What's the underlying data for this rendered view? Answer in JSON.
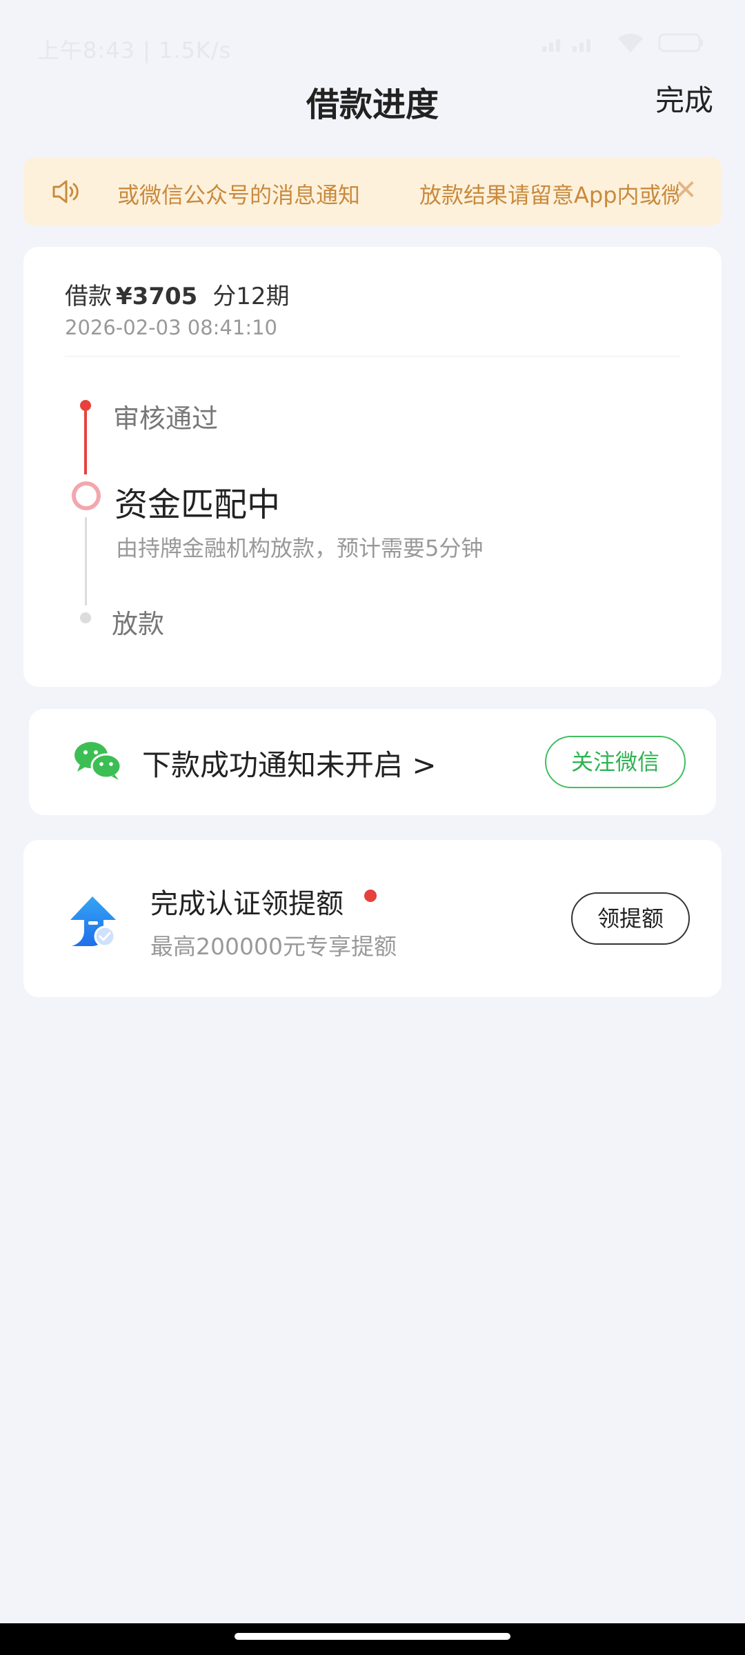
{
  "status_bar": {
    "time_and_speed": "上午8:43 | 1.5K/s"
  },
  "header": {
    "title": "借款进度",
    "done_label": "完成"
  },
  "notice": {
    "text_a": "或微信公众号的消息通知",
    "text_b": "放款结果请留意App内或微",
    "close_glyph": "✕"
  },
  "loan": {
    "prefix": "借款",
    "amount": "¥3705",
    "periods": "分12期",
    "datetime": "2026-02-03 08:41:10"
  },
  "timeline": {
    "steps": [
      {
        "label": "审核通过",
        "status": "done"
      },
      {
        "label": "资金匹配中",
        "status": "current",
        "desc": "由持牌金融机构放款，预计需要5分钟"
      },
      {
        "label": "放款",
        "status": "pending"
      }
    ]
  },
  "wechat": {
    "text": "下款成功通知未开启 >",
    "button_label": "关注微信"
  },
  "credit": {
    "title": "完成认证领提额",
    "subtitle": "最高200000元专享提额",
    "button_label": "领提额"
  },
  "colors": {
    "accent_red": "#e8403d",
    "wechat_green": "#2fb253",
    "notice_text": "#c98a3c",
    "notice_bg": "#fdf1dc"
  }
}
